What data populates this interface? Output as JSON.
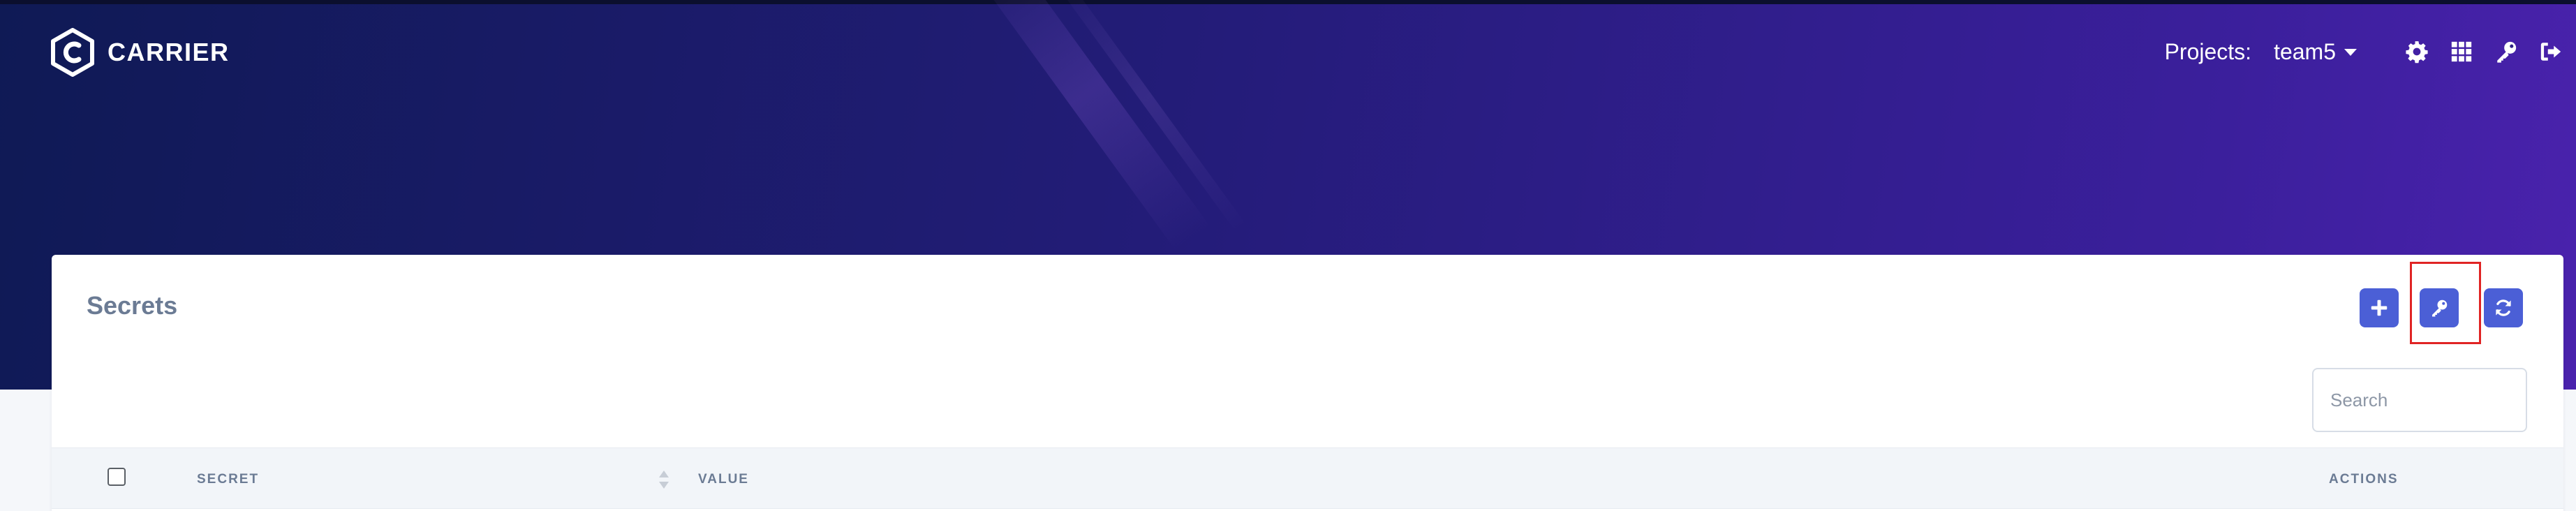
{
  "header": {
    "brand_name": "CARRIER",
    "projects_label": "Projects:",
    "current_project": "team5",
    "nav_icons": [
      "gear-icon",
      "grid-icon",
      "key-icon",
      "sign-out-icon"
    ]
  },
  "secrets_card": {
    "title": "Secrets",
    "toolbar_icons": [
      "plus-icon",
      "key-icon",
      "refresh-icon"
    ],
    "search": {
      "placeholder": "Search",
      "value": ""
    },
    "table": {
      "columns": [
        "SECRET",
        "VALUE",
        "ACTIONS"
      ],
      "rows": []
    }
  },
  "colors": {
    "header_gradient_start": "#0f1a55",
    "header_gradient_end": "#4a22ad",
    "primary_button": "#4b5fd6",
    "highlight_box": "#e02424",
    "title_text": "#6b7b94"
  }
}
